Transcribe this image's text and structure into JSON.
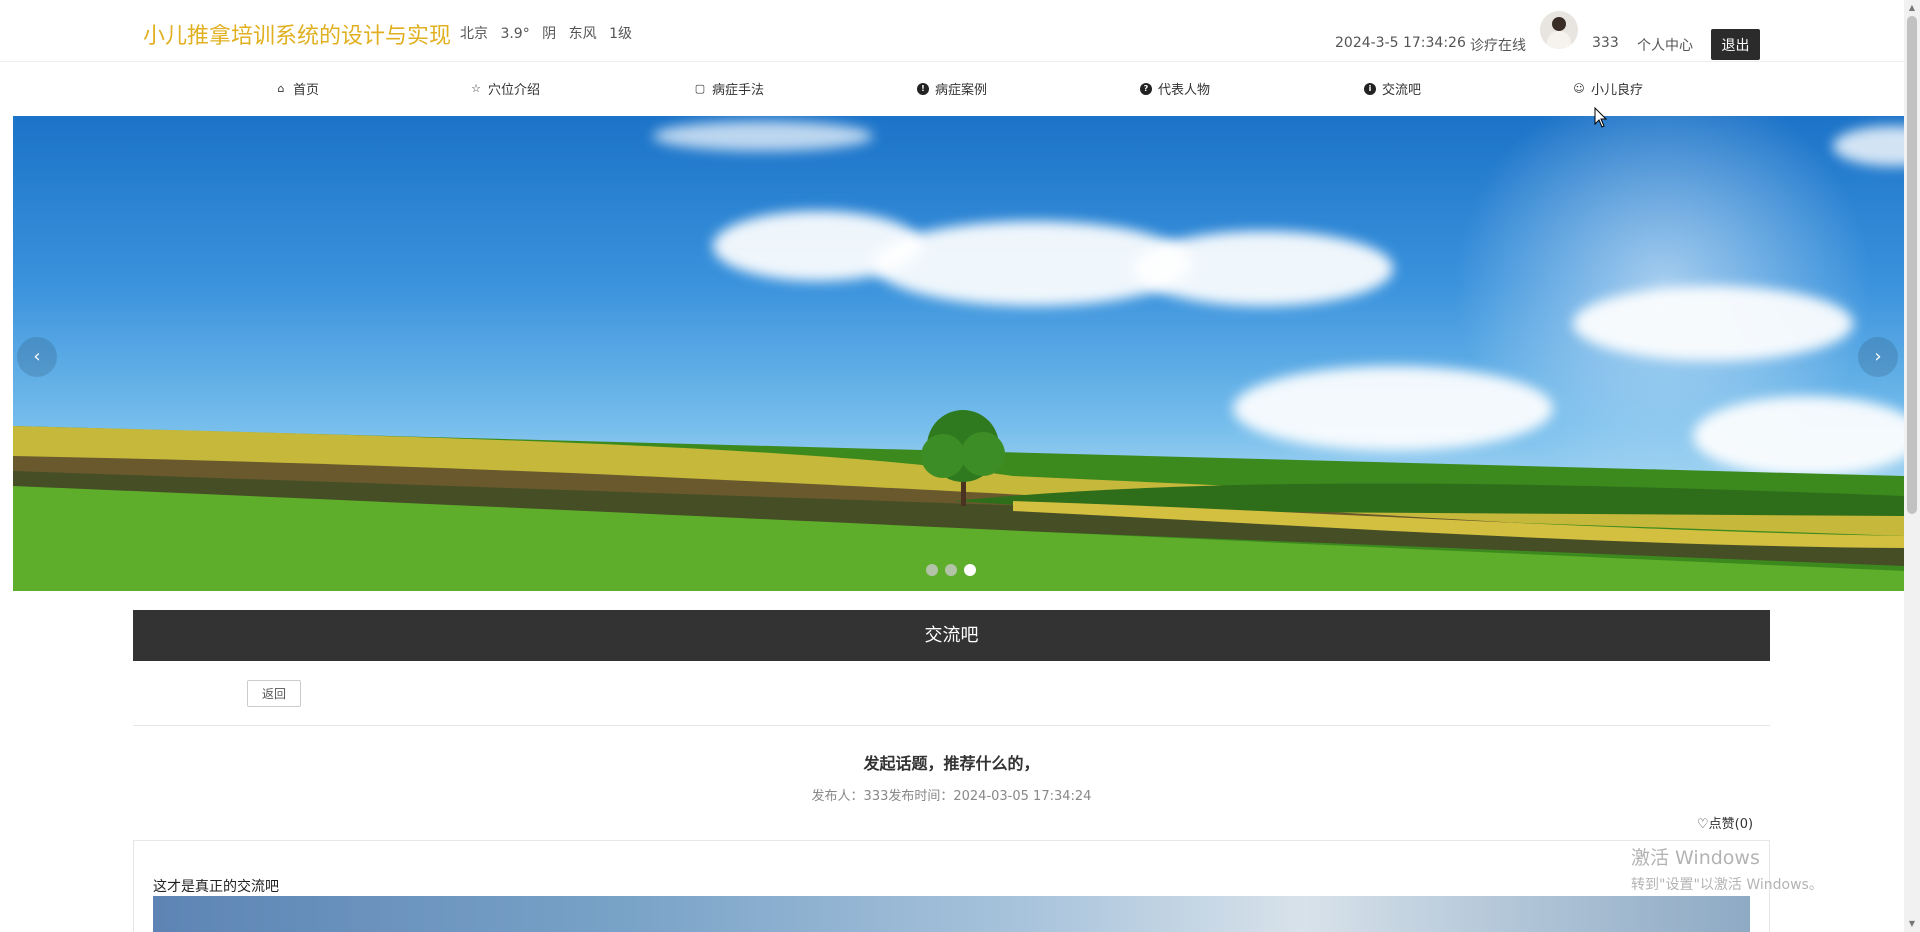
{
  "header": {
    "site_title": "小儿推拿培训系统的设计与实现",
    "weather": {
      "city": "北京",
      "temp": "3.9°",
      "condition": "阴",
      "wind_dir": "东风",
      "wind_level": "1级"
    },
    "datetime": "2024-3-5 17:34:26",
    "online_label": "诊疗在线",
    "username": "333",
    "profile_label": "个人中心",
    "logout_label": "退出"
  },
  "nav": {
    "items": [
      {
        "label": "首页",
        "icon": "home-icon"
      },
      {
        "label": "穴位介绍",
        "icon": "star-icon"
      },
      {
        "label": "病症手法",
        "icon": "bag-icon"
      },
      {
        "label": "病症案例",
        "icon": "exclamation-icon"
      },
      {
        "label": "代表人物",
        "icon": "question-icon"
      },
      {
        "label": "交流吧",
        "icon": "info-icon"
      },
      {
        "label": "小儿良疗",
        "icon": "smile-icon"
      }
    ]
  },
  "banner": {
    "prev_label": "‹",
    "next_label": "›",
    "slide_count": 3,
    "active_slide": 3
  },
  "content": {
    "section_title": "交流吧",
    "back_label": "返回",
    "post_title": "发起话题，推荐什么的，",
    "post_meta": "发布人：333发布时间：2024-03-05 17:34:24",
    "like_label": "点赞(0)",
    "post_text": "这才是真正的交流吧"
  },
  "watermark": {
    "line1": "激活 Windows",
    "line2": "转到\"设置\"以激活 Windows。"
  },
  "colors": {
    "title_accent": "#e0b020",
    "dark_bar": "#333333",
    "logout_bg": "#2b2b2b"
  }
}
